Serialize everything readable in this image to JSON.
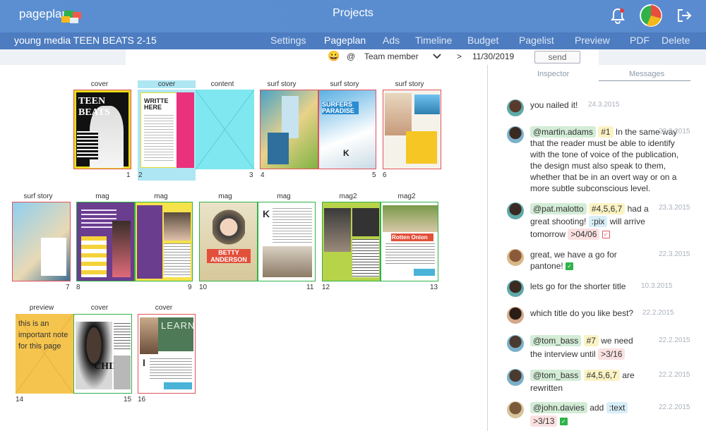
{
  "app": {
    "logo": "pageplanr",
    "title": "Projects"
  },
  "project": {
    "name": "young media TEEN BEATS 2-15"
  },
  "menu": [
    "Settings",
    "Pageplan",
    "Ads",
    "Timeline",
    "Budget",
    "Pagelist",
    "Preview",
    "PDF",
    "Delete"
  ],
  "filter": {
    "emoji": "😀",
    "at": "@",
    "member": "Team member",
    "gt": ">",
    "date": "11/30/2019",
    "send": "send"
  },
  "panel": {
    "tabs": [
      "Inspector",
      "Messages"
    ]
  },
  "pages": {
    "labels": [
      "cover",
      "cover",
      "content",
      "surf story",
      "surf story",
      "surf story",
      "surf story",
      "mag",
      "mag",
      "mag",
      "mag",
      "mag2",
      "mag2",
      "preview",
      "cover",
      "cover"
    ],
    "numbers": [
      "1",
      "2",
      "3",
      "4",
      "5",
      "6",
      "7",
      "8",
      "9",
      "10",
      "11",
      "12",
      "13",
      "14",
      "15",
      "16"
    ],
    "texts": {
      "teen_beats": "TEEN BEATS",
      "writte_here": "WRITTE HERE",
      "surfers_paradise": "SURFERS PARADISE",
      "betty": "BETTY ANDERSON",
      "rotten": "Rotten Onion",
      "learn": "LEARN",
      "note": "this is an important note for this page",
      "k": "K",
      "i": "I",
      "chilli": "CHILLI"
    }
  },
  "messages": [
    {
      "text": "you nailed it!",
      "date": "24.3.2015"
    },
    {
      "user": "@martin.adams",
      "num": "#1",
      "text": "In the same way that the reader must be able to identify with the tone of voice of the publication, the design must also speak to them, whether that be in an overt way or on a more subtle subconscious level.",
      "date": "23.3.2015"
    },
    {
      "user": "@pat.malotto",
      "num": "#4,5,6,7",
      "text1": "had a great shooting!",
      "txt": ":pix",
      "text2": "will arrive tomorrow",
      "due": ">04/06",
      "date": "23.3.2015"
    },
    {
      "text": "great, we have a go for pantone!",
      "date": "22.3.2015"
    },
    {
      "text": "lets go for the shorter title",
      "date": "10.3.2015"
    },
    {
      "text": "which title do you like best?",
      "date": "22.2.2015"
    },
    {
      "user": "@tom_bass",
      "num": "#7",
      "text1": "we need the interview until",
      "due": ">3/16",
      "date": "22.2.2015"
    },
    {
      "user": "@tom_bass",
      "num": "#4,5,6,7",
      "text1": "are rewritten",
      "date": "22.2.2015"
    },
    {
      "user": "@john.davies",
      "text1": "add",
      "txt": ":text",
      "due": ">3/13",
      "date": "22.2.2015"
    }
  ],
  "colors": {
    "topbar": "#5b8fd1",
    "subbar": "#4d7cc0",
    "selected": "#aee6f3"
  }
}
